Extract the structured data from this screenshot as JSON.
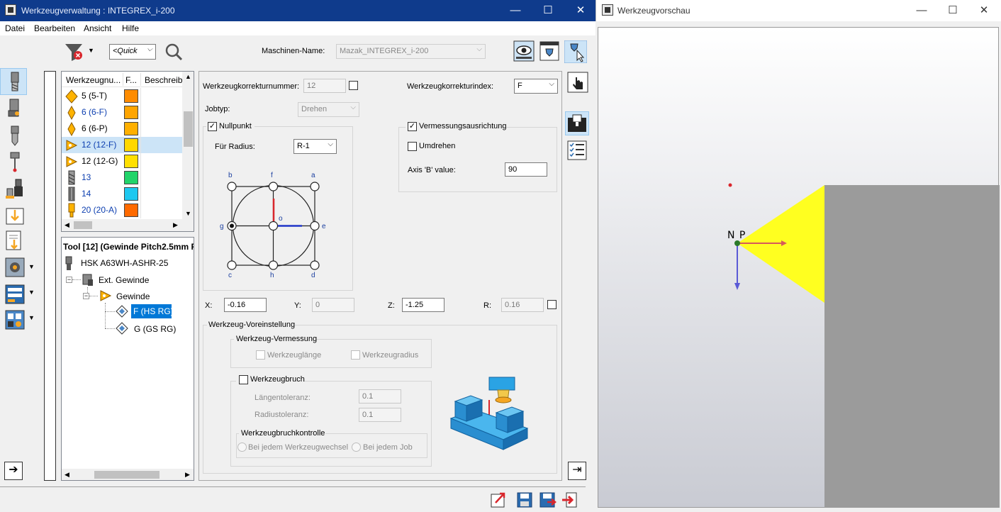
{
  "main_window": {
    "title": "Werkzeugverwaltung : INTEGREX_i-200",
    "controls": {
      "minimize": "—",
      "maximize": "☐",
      "close": "✕"
    }
  },
  "menu": [
    "Datei",
    "Bearbeiten",
    "Ansicht",
    "Hilfe"
  ],
  "toolbar": {
    "quick_placeholder": "<Quick",
    "machine_label": "Maschinen-Name:",
    "machine_value": "Mazak_INTEGREX_i-200"
  },
  "tool_list": {
    "headers": [
      "Werkzeugnu...",
      "F...",
      "Beschreib"
    ],
    "rows": [
      {
        "name": "5 (5-T)",
        "color": "#ff8c00",
        "blue": false
      },
      {
        "name": "6 (6-F)",
        "color": "#ffa500",
        "blue": true
      },
      {
        "name": "6 (6-P)",
        "color": "#ffb000",
        "blue": false
      },
      {
        "name": "12 (12-F)",
        "color": "#ffd800",
        "blue": true
      },
      {
        "name": "12 (12-G)",
        "color": "#ffe000",
        "blue": false
      },
      {
        "name": "13",
        "color": "#22d46a",
        "blue": true
      },
      {
        "name": "14",
        "color": "#1ec8f0",
        "blue": true
      },
      {
        "name": "20 (20-A)",
        "color": "#ff6a00",
        "blue": true
      }
    ]
  },
  "tool_tree": {
    "header": "Tool [12] (Gewinde Pitch2.5mm R",
    "holder": "HSK A63WH-ASHR-25",
    "ext": "Ext. Gewinde",
    "gewinde": "Gewinde",
    "item_f": "F (HS RG)",
    "item_g": "G (GS RG)"
  },
  "form": {
    "korrekturnummer_label": "Werkzeugkorrekturnummer:",
    "korrekturnummer_value": "12",
    "korrekturindex_label": "Werkzeugkorrekturindex:",
    "korrekturindex_value": "F",
    "jobtyp_label": "Jobtyp:",
    "jobtyp_value": "Drehen",
    "nullpunkt_label": "Nullpunkt",
    "fuer_radius_label": "Für Radius:",
    "fuer_radius_value": "R-1",
    "vermessung_label": "Vermessungsausrichtung",
    "umdrehen_label": "Umdrehen",
    "axis_b_label": "Axis 'B' value:",
    "axis_b_value": "90",
    "x_label": "X:",
    "x_value": "-0.16",
    "y_label": "Y:",
    "y_value": "0",
    "z_label": "Z:",
    "z_value": "-1.25",
    "r_label": "R:",
    "r_value": "0.16",
    "voreinstellung_label": "Werkzeug-Voreinstellung",
    "vermessung_group": "Werkzeug-Vermessung",
    "laenge_label": "Werkzeuglänge",
    "radius_label": "Werkzeugradius",
    "bruch_label": "Werkzeugbruch",
    "laengentol_label": "Längentoleranz:",
    "laengentol_value": "0.1",
    "radiustol_label": "Radiustoleranz:",
    "radiustol_value": "0.1",
    "bruchkontrolle_label": "Werkzeugbruchkontrolle",
    "radio_wechsel": "Bei jedem Werkzeugwechsel",
    "radio_job": "Bei jedem Job"
  },
  "origin_diagram": {
    "points": [
      "b",
      "f",
      "a",
      "g",
      "o",
      "e",
      "c",
      "h",
      "d"
    ],
    "selected": "g"
  },
  "preview_window": {
    "title": "Werkzeugvorschau",
    "label": "N P"
  }
}
